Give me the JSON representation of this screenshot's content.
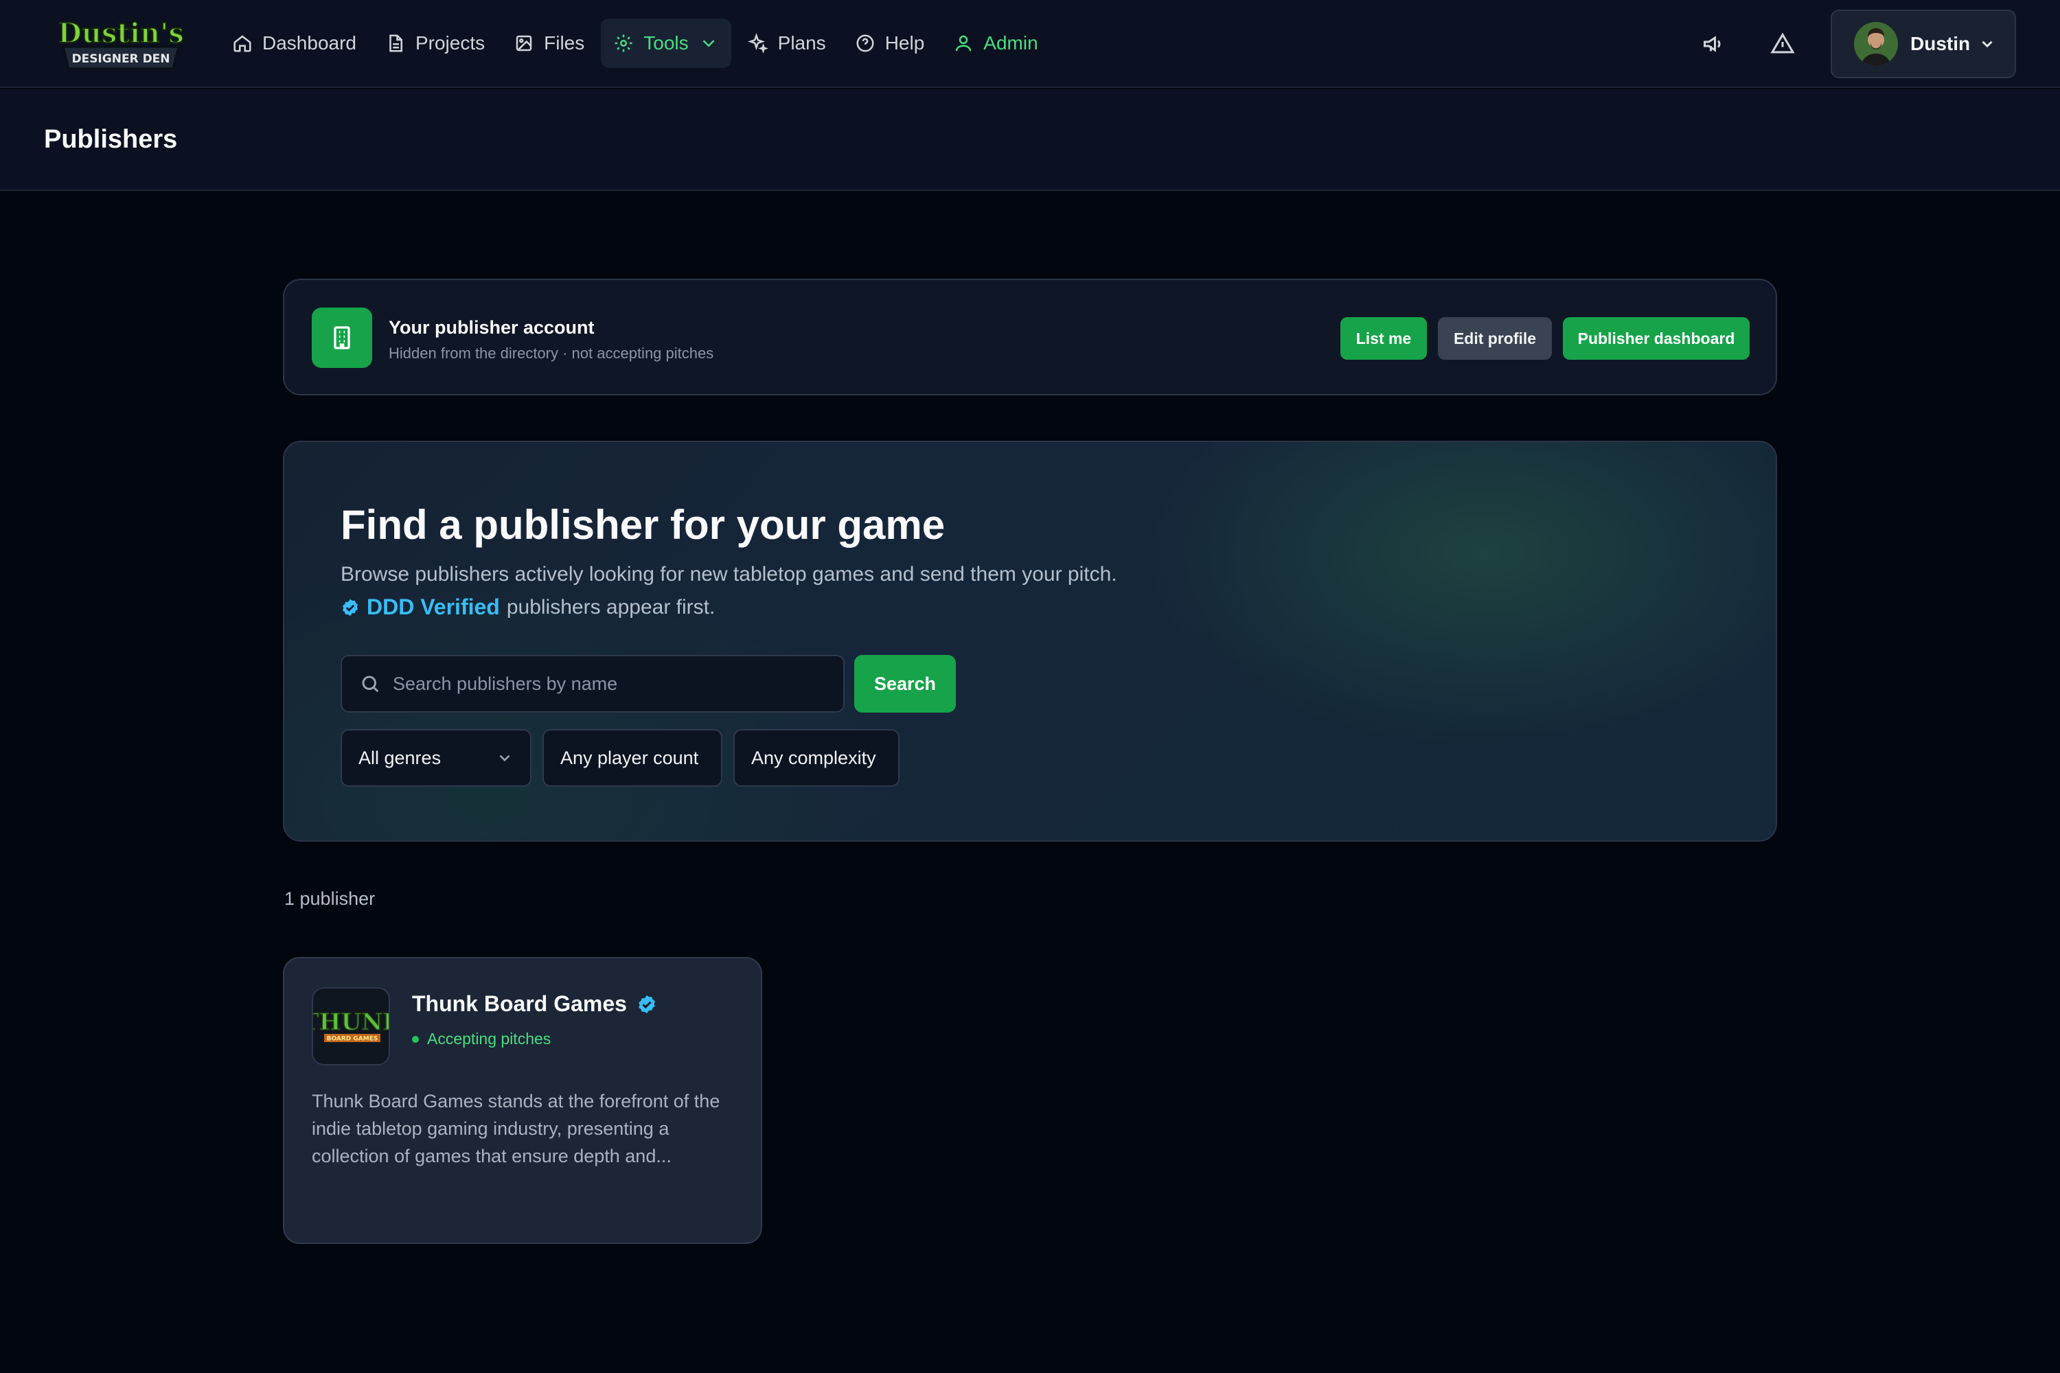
{
  "nav": {
    "logo_text_top": "Dustin's",
    "logo_text_bottom": "DESIGNER DEN",
    "items": [
      {
        "label": "Dashboard",
        "icon": "home-icon"
      },
      {
        "label": "Projects",
        "icon": "document-icon"
      },
      {
        "label": "Files",
        "icon": "image-icon"
      },
      {
        "label": "Tools",
        "icon": "gear-icon",
        "active": true
      },
      {
        "label": "Plans",
        "icon": "sparkle-icon"
      },
      {
        "label": "Help",
        "icon": "help-circle-icon"
      },
      {
        "label": "Admin",
        "icon": "user-icon"
      }
    ],
    "user_name": "Dustin"
  },
  "page": {
    "title": "Publishers"
  },
  "account": {
    "title": "Your publisher account",
    "subtitle": "Hidden from the directory · not accepting pitches",
    "list_me": "List me",
    "edit_profile": "Edit profile",
    "publisher_dashboard": "Publisher dashboard"
  },
  "hero": {
    "heading": "Find a publisher for your game",
    "lead": "Browse publishers actively looking for new tabletop games and send them your pitch.",
    "verified_label": "DDD Verified",
    "lead_suffix": "publishers appear first.",
    "search_placeholder": "Search publishers by name",
    "search_button": "Search",
    "filters": {
      "genre": "All genres",
      "players": "Any player count",
      "complexity": "Any complexity"
    }
  },
  "results": {
    "count_label": "1 publisher",
    "publishers": [
      {
        "name": "Thunk Board Games",
        "logo_text": "THUNK",
        "logo_sub": "BOARD GAMES",
        "status": "Accepting pitches",
        "description": "Thunk Board Games stands at the forefront of the indie tabletop gaming industry, presenting a collection of games that ensure depth and..."
      }
    ]
  },
  "colors": {
    "accent_green": "#16a34a",
    "active_green": "#4ade80",
    "verified_blue": "#38bdf8",
    "background": "#02060f"
  }
}
